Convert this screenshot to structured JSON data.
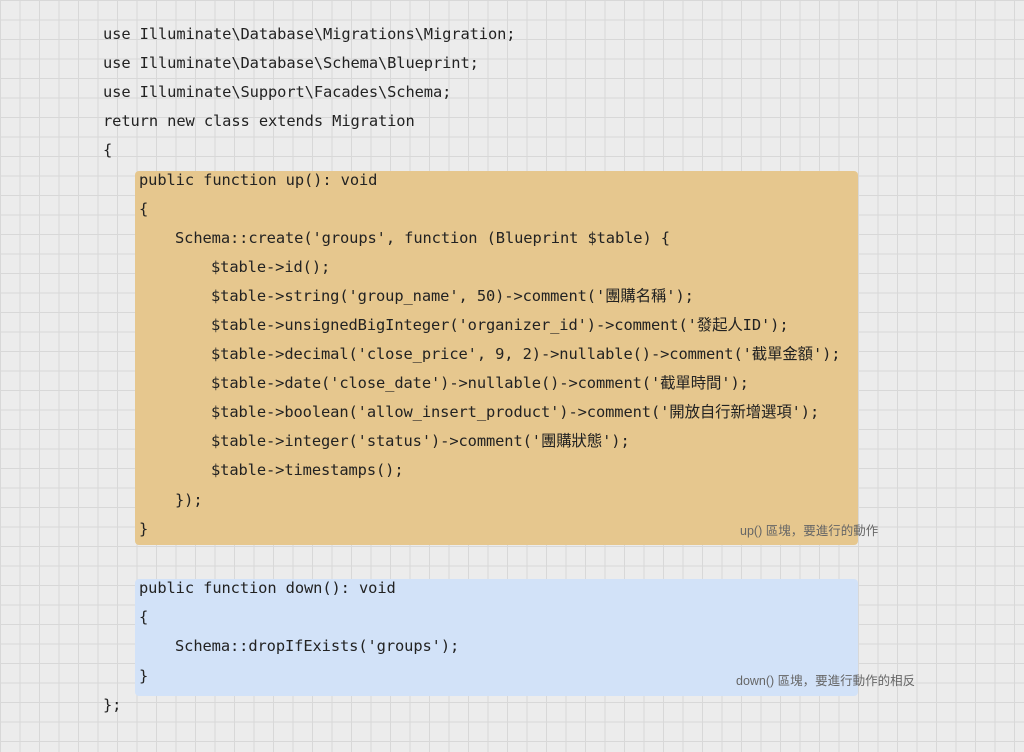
{
  "code": {
    "lines": [
      "use Illuminate\\Database\\Migrations\\Migration;",
      "use Illuminate\\Database\\Schema\\Blueprint;",
      "use Illuminate\\Support\\Facades\\Schema;",
      "return new class extends Migration",
      "{",
      "public function up(): void",
      "{",
      "Schema::create('groups', function (Blueprint $table) {",
      "$table->id();",
      "$table->string('group_name', 50)->comment('團購名稱');",
      "$table->unsignedBigInteger('organizer_id')->comment('發起人ID');",
      "$table->decimal('close_price', 9, 2)->nullable()->comment('截單金額');",
      "$table->date('close_date')->nullable()->comment('截單時間');",
      "$table->boolean('allow_insert_product')->comment('開放自行新增選項');",
      "$table->integer('status')->comment('團購狀態');",
      "$table->timestamps();",
      "});",
      "}",
      "public function down(): void",
      "{",
      "Schema::dropIfExists('groups');",
      "}",
      "};"
    ]
  },
  "annotations": {
    "up_note": "up() 區塊，要進行的動作",
    "down_note": "down() 區塊，要進行動作的相反"
  },
  "colors": {
    "up_block": "#e6c78e",
    "down_block": "#d2e2f8",
    "background": "#ececec",
    "grid": "#d8d8d8"
  }
}
